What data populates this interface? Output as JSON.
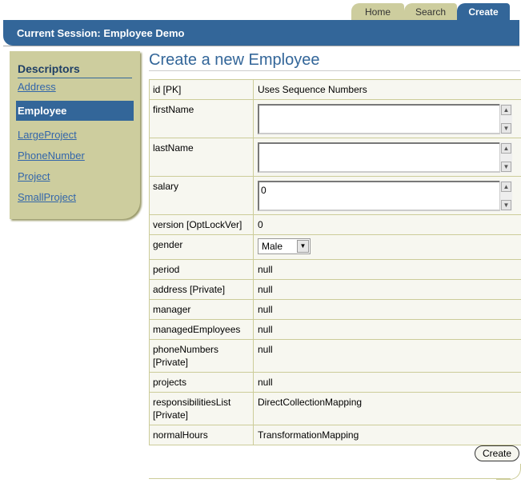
{
  "tabs": {
    "home": "Home",
    "search": "Search",
    "create": "Create"
  },
  "header": {
    "session": "Current Session: Employee Demo"
  },
  "sidebar": {
    "title": "Descriptors",
    "items": [
      {
        "label": "Address"
      },
      {
        "label": "Employee"
      },
      {
        "label": "LargeProject"
      },
      {
        "label": "PhoneNumber"
      },
      {
        "label": "Project"
      },
      {
        "label": "SmallProject"
      }
    ]
  },
  "page": {
    "title": "Create a new Employee"
  },
  "form": {
    "rows": [
      {
        "label": "id [PK]",
        "value": "Uses Sequence Numbers"
      },
      {
        "label": "firstName",
        "value": ""
      },
      {
        "label": "lastName",
        "value": ""
      },
      {
        "label": "salary",
        "value": "0"
      },
      {
        "label": "version [OptLockVer]",
        "value": "0"
      },
      {
        "label": "gender",
        "value": "Male"
      },
      {
        "label": "period",
        "value": "null"
      },
      {
        "label": "address [Private]",
        "value": "null"
      },
      {
        "label": "manager",
        "value": "null"
      },
      {
        "label": "managedEmployees",
        "value": "null"
      },
      {
        "label": "phoneNumbers\n[Private]",
        "value": "null"
      },
      {
        "label": "projects",
        "value": "null"
      },
      {
        "label": "responsibilitiesList\n[Private]",
        "value": "DirectCollectionMapping"
      },
      {
        "label": "normalHours",
        "value": "TransformationMapping"
      }
    ]
  },
  "actions": {
    "create_button": "Create"
  },
  "colors": {
    "accent": "#336699",
    "panel": "#cdcd9e"
  }
}
